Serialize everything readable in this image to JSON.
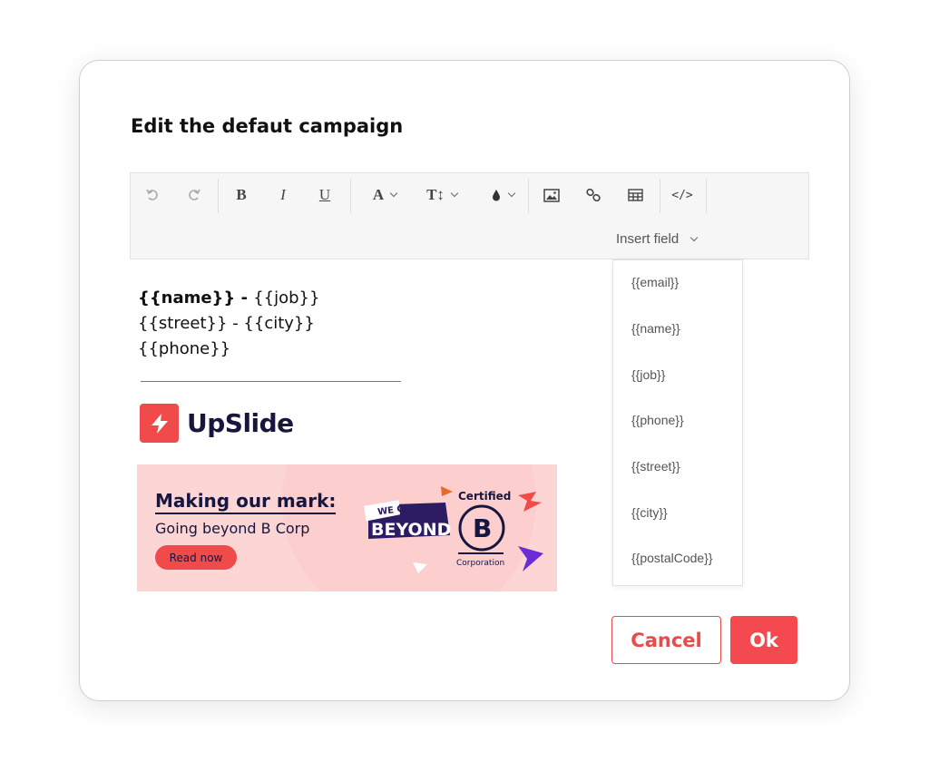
{
  "dialog": {
    "title": "Edit the defaut campaign"
  },
  "toolbar": {
    "undo_icon": "undo-icon",
    "redo_icon": "redo-icon",
    "bold": "B",
    "italic": "I",
    "underline": "U",
    "font_color": "A",
    "text_size": "T↕",
    "highlight_icon": "ink-drop-icon",
    "image_icon": "image-icon",
    "link_icon": "link-icon",
    "table_icon": "table-icon",
    "source": "</>",
    "insert_field_label": "Insert field"
  },
  "signature": {
    "name": "{{name}}",
    "name_sep": " - ",
    "job": "{{job}}",
    "street": "{{street}}",
    "street_sep": " - ",
    "city": "{{city}}",
    "phone": "{{phone}}"
  },
  "logo": {
    "text": "UpSlide"
  },
  "banner": {
    "headline": "Making our mark:",
    "subline": "Going beyond B Corp",
    "cta": "Read now",
    "badge_small": "WE GO",
    "badge_big": "BEYOND",
    "certified": "Certified",
    "b_letter": "B",
    "corporation": "Corporation"
  },
  "insert_field_menu": {
    "items": [
      "{{email}}",
      "{{name}}",
      "{{job}}",
      "{{phone}}",
      "{{street}}",
      "{{city}}",
      "{{postalCode}}"
    ]
  },
  "actions": {
    "cancel": "Cancel",
    "ok": "Ok"
  },
  "colors": {
    "accent": "#f44a4f",
    "logo_navy": "#16163f",
    "banner_bg": "#fcd5d5"
  }
}
